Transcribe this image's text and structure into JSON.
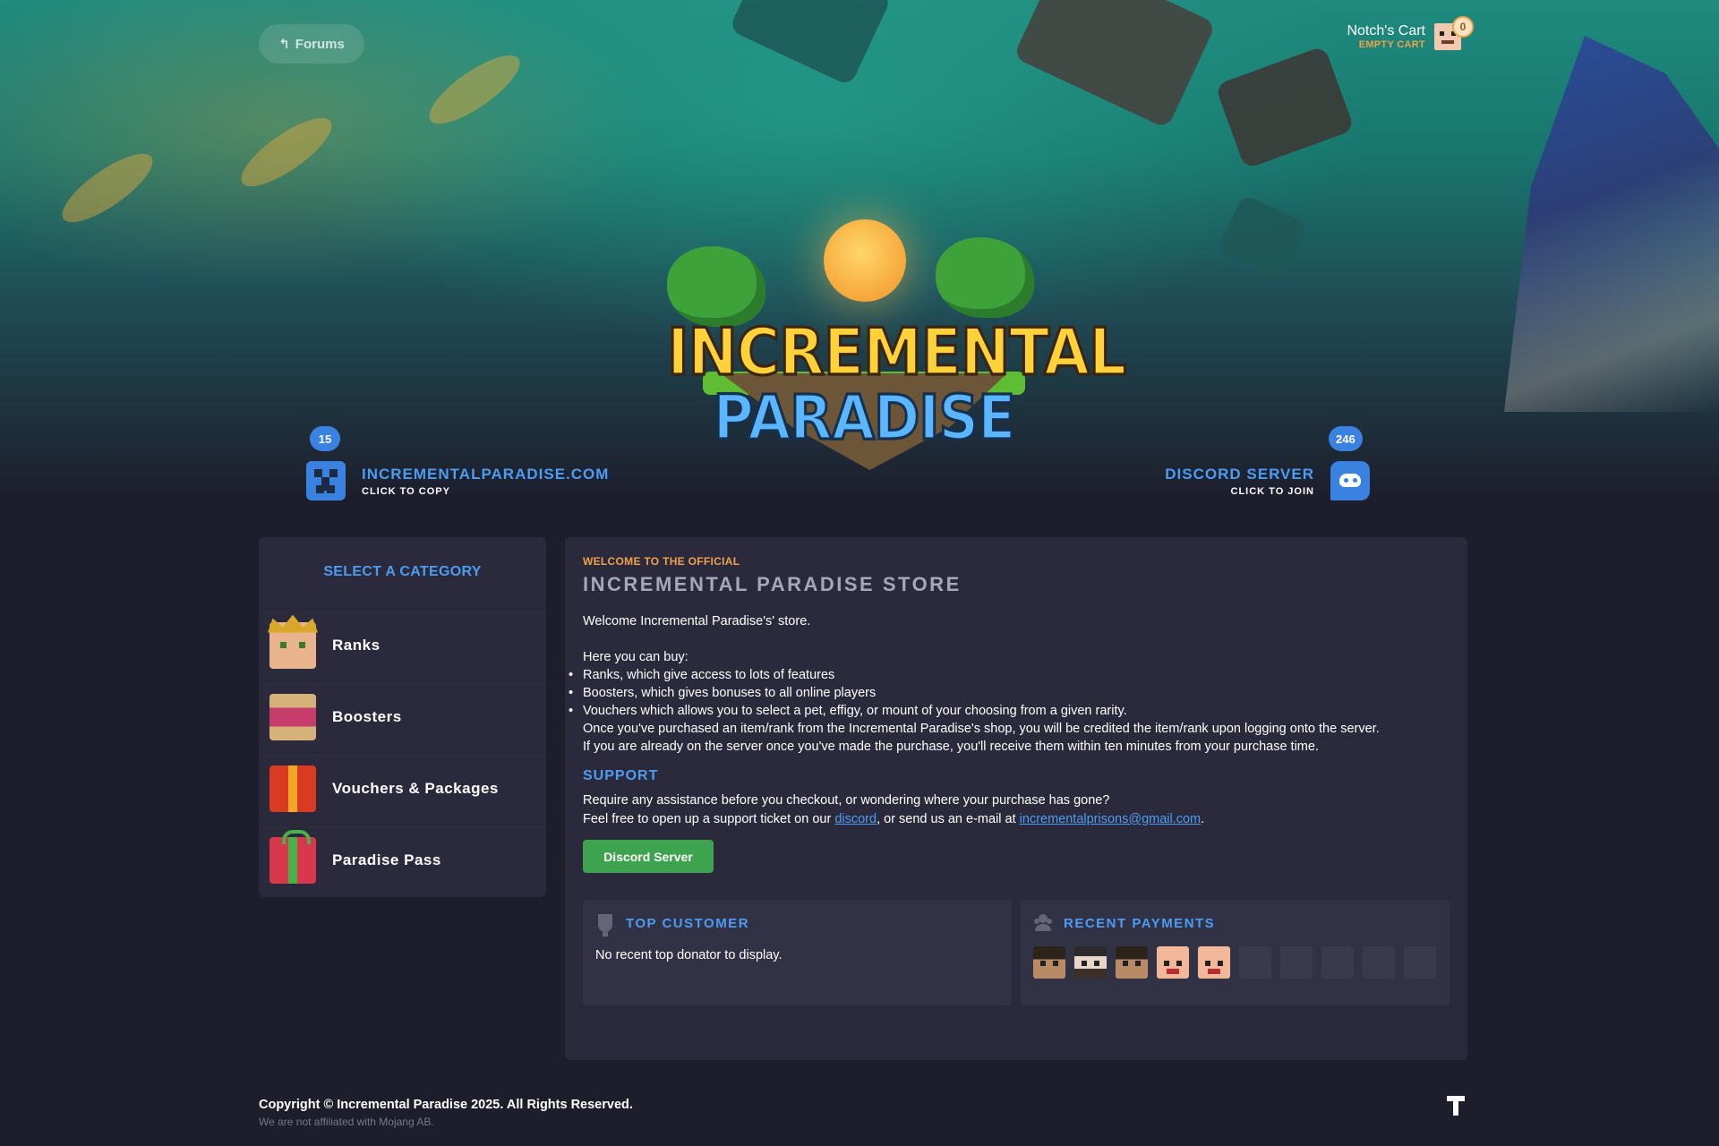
{
  "header": {
    "forums_label": "Forums",
    "cart_title": "Notch's Cart",
    "cart_status": "EMPTY CART",
    "cart_count": "0"
  },
  "logo": {
    "line1": "INCREMENTAL",
    "line2": "PARADISE"
  },
  "server": {
    "players_online": "15",
    "address": "INCREMENTALPARADISE.COM",
    "action": "CLICK TO COPY"
  },
  "discord": {
    "members_online": "246",
    "title": "DISCORD SERVER",
    "action": "CLICK TO JOIN"
  },
  "sidebar": {
    "heading": "SELECT A CATEGORY",
    "items": [
      {
        "label": "Ranks",
        "icon": "crowned-head-icon"
      },
      {
        "label": "Boosters",
        "icon": "chest-icon"
      },
      {
        "label": "Vouchers & Packages",
        "icon": "gift-box-icon"
      },
      {
        "label": "Paradise Pass",
        "icon": "present-icon"
      }
    ]
  },
  "main": {
    "kicker": "WELCOME TO THE OFFICIAL",
    "title": "INCREMENTAL PARADISE STORE",
    "intro": "Welcome Incremental Paradise's' store.",
    "buy_heading": "Here you can buy:",
    "bullets": [
      "Ranks, which give access to lots of features",
      "Boosters, which gives bonuses to all online players",
      "Vouchers which allows you to select a pet, effigy, or mount of your choosing from a given rarity."
    ],
    "credit_note": "Once you've purchased an item/rank from the Incremental Paradise's shop, you will be credited the item/rank upon logging onto the server.",
    "online_note": "If you are already on the server once you've made the purchase, you'll receive them within ten minutes from your purchase time.",
    "support_title": "SUPPORT",
    "support_line1": "Require any assistance before you checkout, or wondering where your purchase has gone?",
    "support_line2_a": "Feel free to open up a support ticket on our ",
    "support_link_discord": "discord",
    "support_line2_b": ", or send us an e-mail at ",
    "support_email": "incrementalprisons@gmail.com",
    "support_line2_c": ".",
    "discord_button": "Discord Server"
  },
  "top_customer": {
    "title": "TOP CUSTOMER",
    "empty_text": "No recent top donator to display."
  },
  "recent_payments": {
    "title": "RECENT PAYMENTS"
  },
  "footer": {
    "copyright": "Copyright © Incremental Paradise 2025. All Rights Reserved.",
    "affiliation": "We are not affiliated with Mojang AB."
  },
  "colors": {
    "accent_blue": "#4d9cf2",
    "accent_orange": "#f0a24a",
    "button_green": "#3ea34e",
    "panel": "#2a2a3c",
    "background": "#1d1d2b"
  }
}
